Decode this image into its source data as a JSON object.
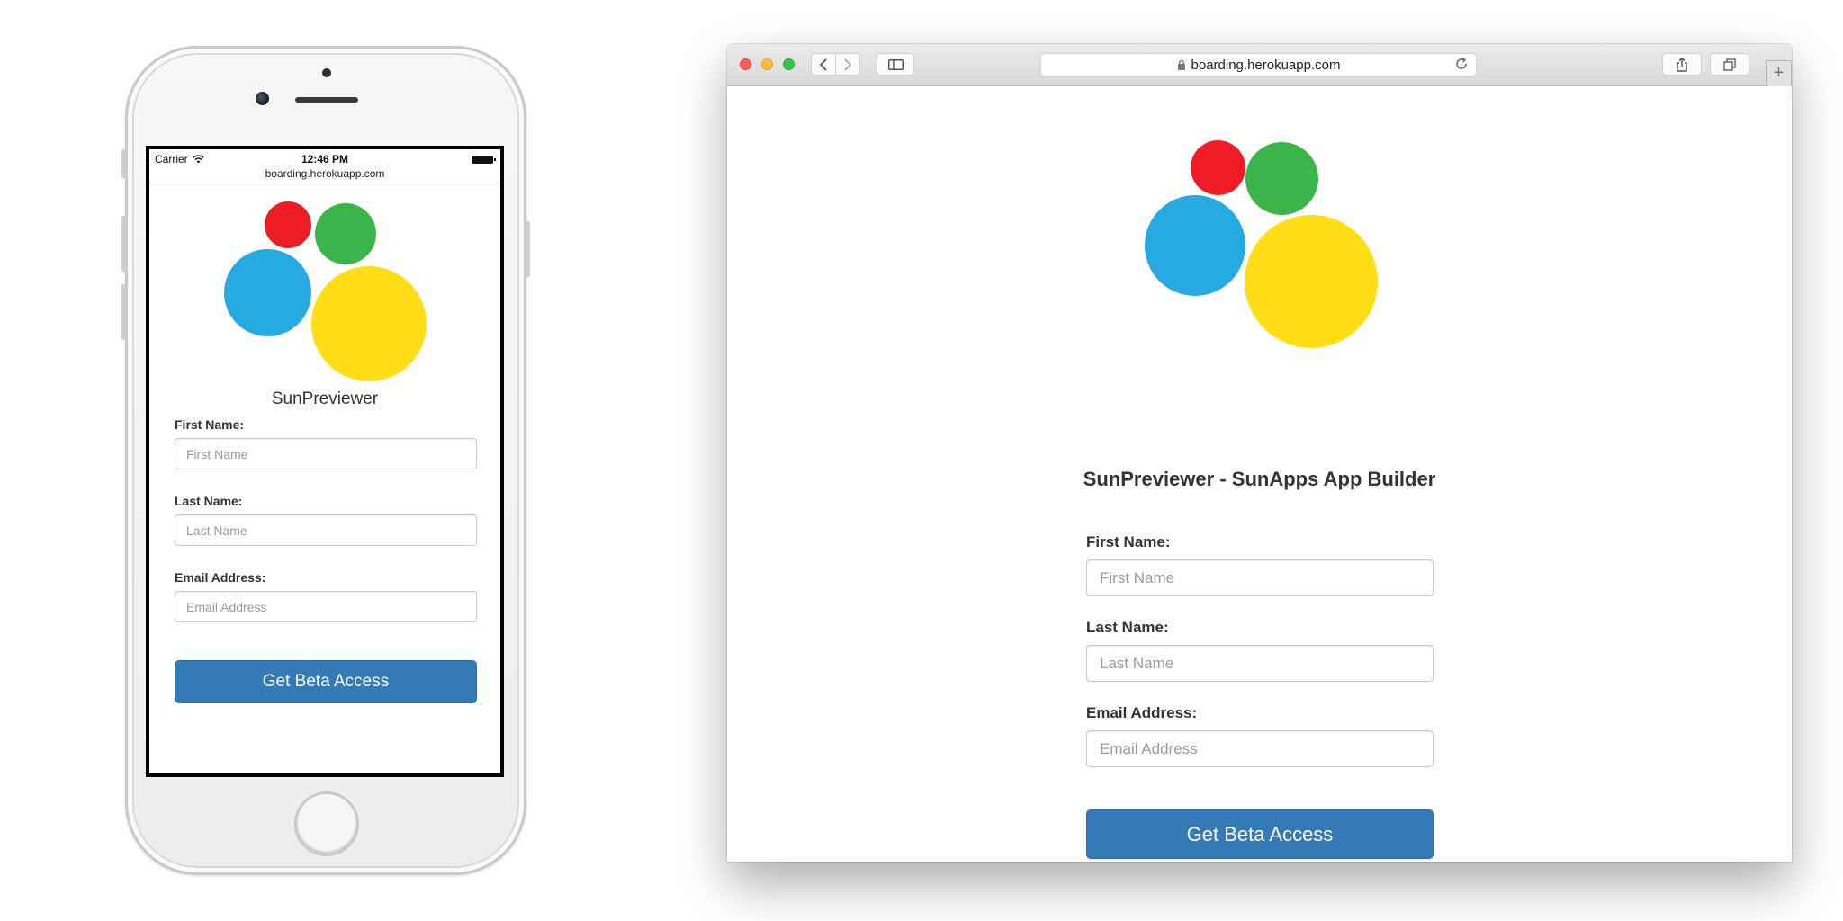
{
  "phone": {
    "status": {
      "carrier": "Carrier",
      "time": "12:46 PM"
    },
    "url": "boarding.herokuapp.com",
    "title": "SunPreviewer",
    "fields": [
      {
        "label": "First Name:",
        "placeholder": "First Name"
      },
      {
        "label": "Last Name:",
        "placeholder": "Last Name"
      },
      {
        "label": "Email Address:",
        "placeholder": "Email Address"
      }
    ],
    "button": "Get Beta Access"
  },
  "browser": {
    "url": "boarding.herokuapp.com",
    "title": "SunPreviewer - SunApps App Builder",
    "fields": [
      {
        "label": "First Name:",
        "placeholder": "First Name"
      },
      {
        "label": "Last Name:",
        "placeholder": "Last Name"
      },
      {
        "label": "Email Address:",
        "placeholder": "Email Address"
      }
    ],
    "button": "Get Beta Access"
  },
  "logo_colors": {
    "red": "#ee1d25",
    "green": "#3bb54a",
    "blue": "#27aae1",
    "yellow": "#ffde17"
  },
  "primary_color": "#337ab7",
  "icons": [
    "wifi-icon",
    "battery-icon",
    "back-icon",
    "forward-icon",
    "sidebar-icon",
    "lock-icon",
    "reload-icon",
    "share-icon",
    "tabs-icon",
    "new-tab-icon"
  ]
}
